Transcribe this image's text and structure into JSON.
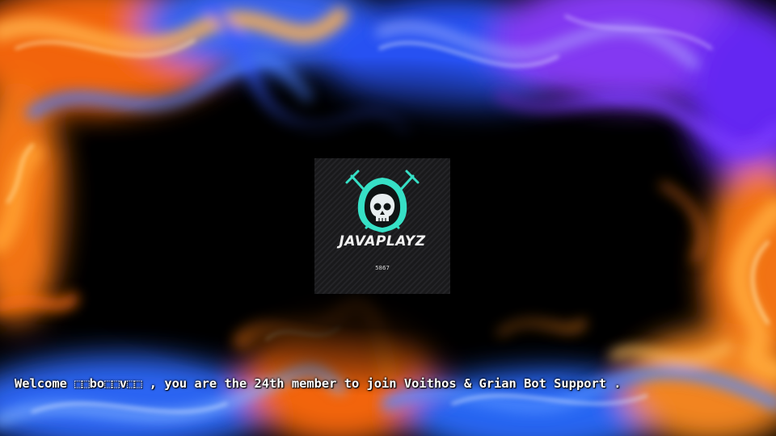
{
  "banner": {
    "logo": {
      "title": "JAVAPLAYZ",
      "tag": "5867"
    },
    "welcome_message": "Welcome ⬚⬚bo⬚⬚v⬚⬚ , you are the 24th member to join Voithos & Grian Bot Support ."
  },
  "colors": {
    "background": "#000000",
    "flame_orange": "#ff7a12",
    "flame_blue": "#2a6cff",
    "flame_purple": "#8a3cff",
    "logo_teal": "#36e0c6",
    "text": "#ffffff"
  },
  "icons": [
    "hooded-skull-icon",
    "crossed-swords-icon"
  ]
}
